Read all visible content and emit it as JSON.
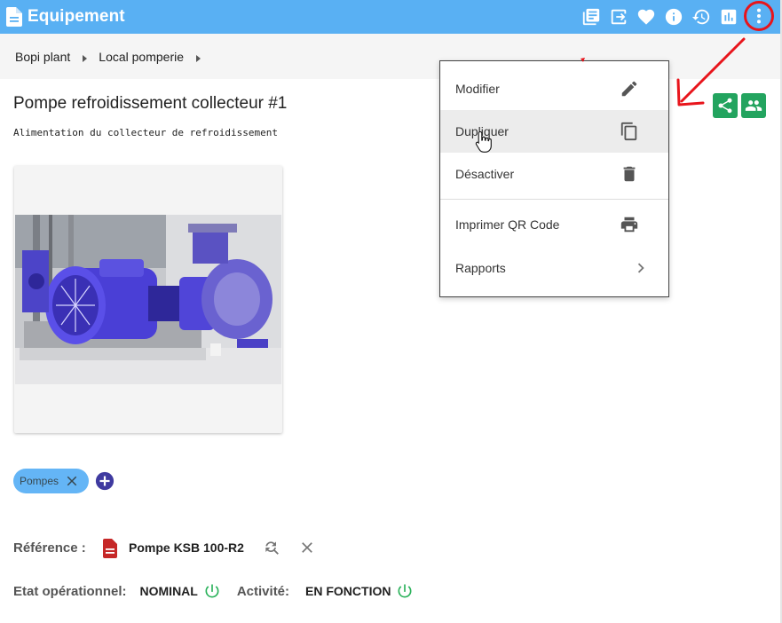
{
  "app": {
    "title": "Equipement"
  },
  "toolbar": {
    "icons": [
      "library-icon",
      "exit-icon",
      "heart-icon",
      "info-icon",
      "history-icon",
      "chart-icon",
      "more-vert-icon"
    ]
  },
  "breadcrumb": {
    "items": [
      "Bopi plant",
      "Local pomperie"
    ]
  },
  "equipment": {
    "title": "Pompe refroidissement collecteur #1",
    "description": "Alimentation du collecteur de refroidissement"
  },
  "tags": [
    "Pompes"
  ],
  "reference": {
    "label": "Référence :",
    "value": "Pompe KSB 100-R2"
  },
  "status": {
    "operational_label": "Etat opérationnel:",
    "operational_value": "NOMINAL",
    "activity_label": "Activité:",
    "activity_value": "EN FONCTION"
  },
  "menu": {
    "items": [
      {
        "label": "Modifier",
        "icon": "pencil-icon"
      },
      {
        "label": "Dupliquer",
        "icon": "copy-icon"
      },
      {
        "label": "Désactiver",
        "icon": "trash-icon"
      },
      {
        "label": "Imprimer QR Code",
        "icon": "printer-icon"
      },
      {
        "label": "Rapports",
        "icon": "chevron-right-icon"
      }
    ],
    "hovered_index": 1
  },
  "colors": {
    "topbar": "#59b0f3",
    "green_action": "#23a45f",
    "tag": "#64b5f6",
    "annotation_red": "#e8141b",
    "power_green": "#2bb25b",
    "pdf_red": "#c62828"
  }
}
